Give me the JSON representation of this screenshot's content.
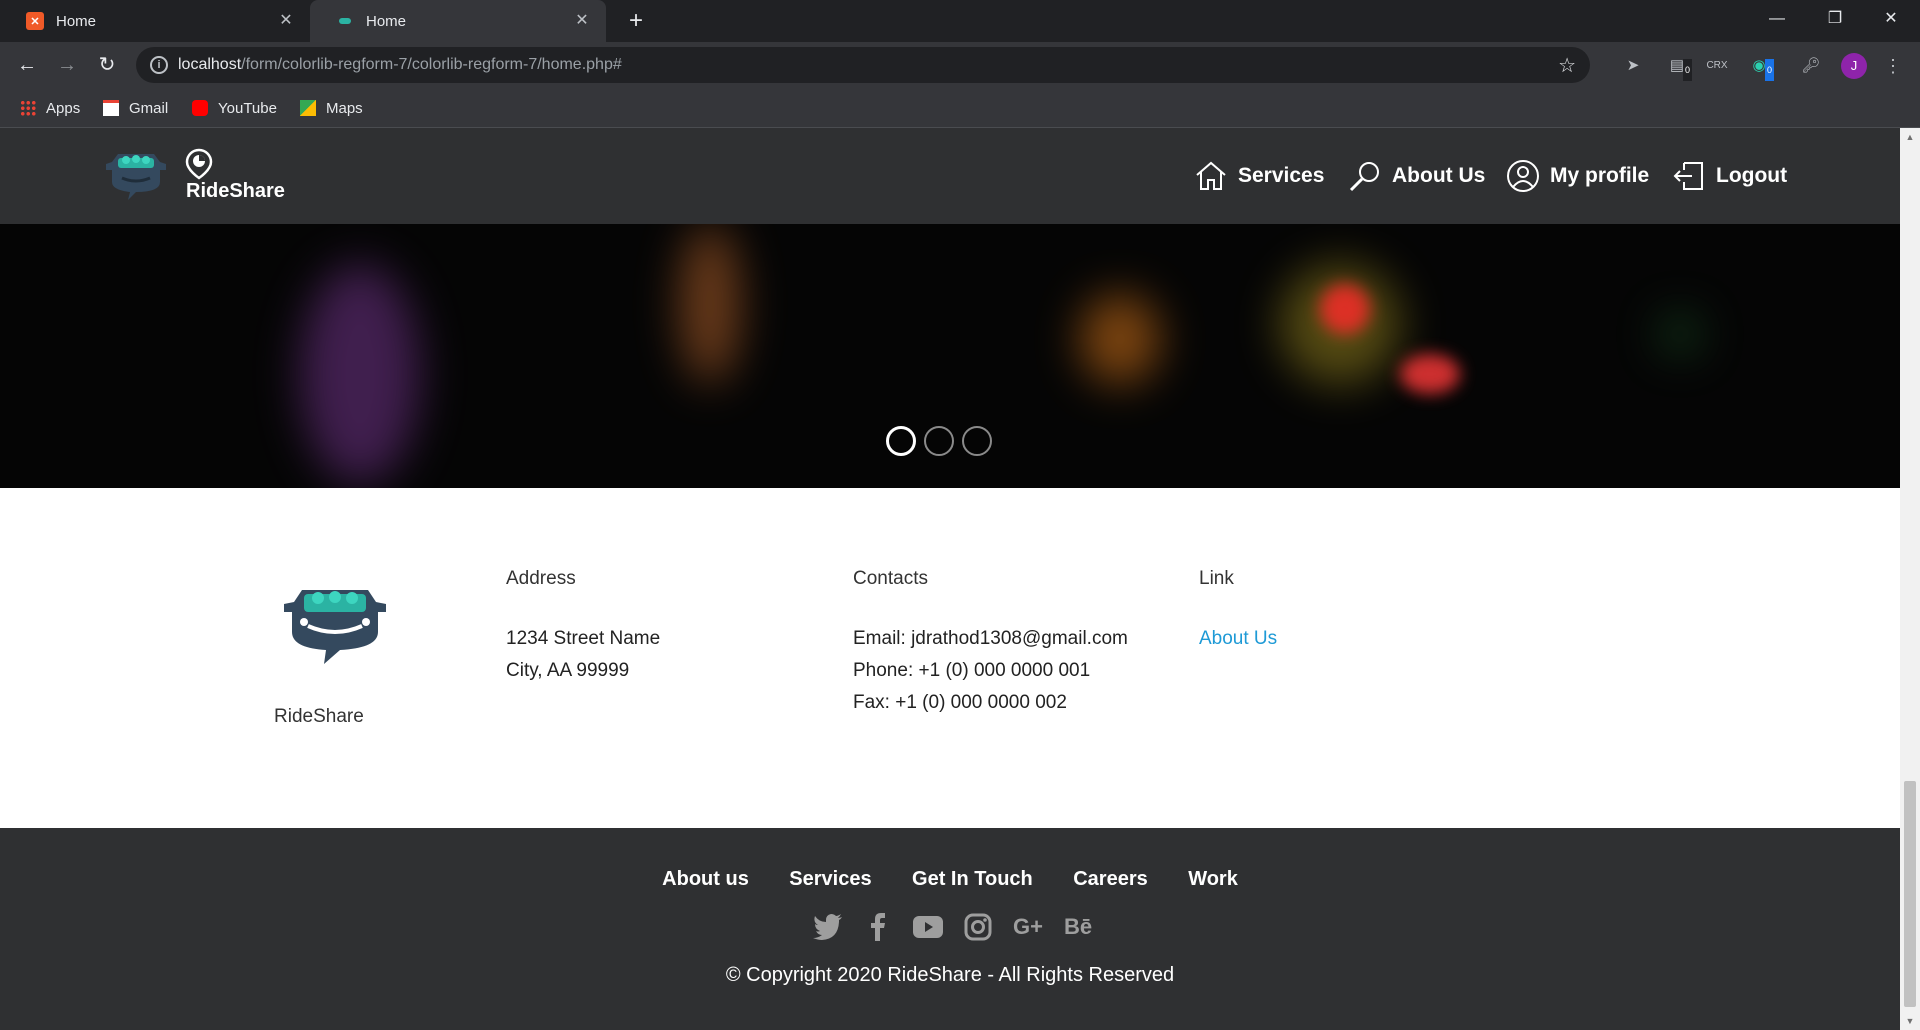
{
  "browser": {
    "tabs": [
      {
        "title": "Home",
        "favicon_color": "#f05a28"
      },
      {
        "title": "Home",
        "favicon_color": "#2bb3a3"
      }
    ],
    "new_tab_label": "+",
    "url_host": "localhost",
    "url_path": "/form/colorlib-regform-7/colorlib-regform-7/home.php#",
    "avatar_letter": "J",
    "bookmarks": [
      {
        "label": "Apps"
      },
      {
        "label": "Gmail"
      },
      {
        "label": "YouTube"
      },
      {
        "label": "Maps"
      }
    ],
    "extension_badges": [
      "0",
      "0"
    ]
  },
  "site": {
    "brand": "RideShare",
    "nav": [
      {
        "label": "Services",
        "icon": "home-icon"
      },
      {
        "label": "About Us",
        "icon": "search-icon"
      },
      {
        "label": "My profile",
        "icon": "user-icon"
      },
      {
        "label": "Logout",
        "icon": "logout-icon"
      }
    ],
    "carousel": {
      "slides": 3,
      "active": 0
    }
  },
  "footer": {
    "brand": "RideShare",
    "address": {
      "title": "Address",
      "lines": [
        "1234 Street Name",
        "City, AA 99999"
      ]
    },
    "contacts": {
      "title": "Contacts",
      "lines": [
        "Email: jdrathod1308@gmail.com",
        "Phone: +1 (0) 000 0000 001",
        "Fax: +1 (0) 000 0000 002"
      ]
    },
    "link": {
      "title": "Link",
      "items": [
        "About Us"
      ]
    },
    "bottom_nav": [
      "About us",
      "Services",
      "Get In Touch",
      "Careers",
      "Work"
    ],
    "social": [
      "twitter-icon",
      "facebook-icon",
      "youtube-icon",
      "instagram-icon",
      "google-plus-icon",
      "behance-icon"
    ],
    "copyright": "© Copyright 2020 RideShare - All Rights Reserved",
    "link_color": "#1e9ad6"
  }
}
